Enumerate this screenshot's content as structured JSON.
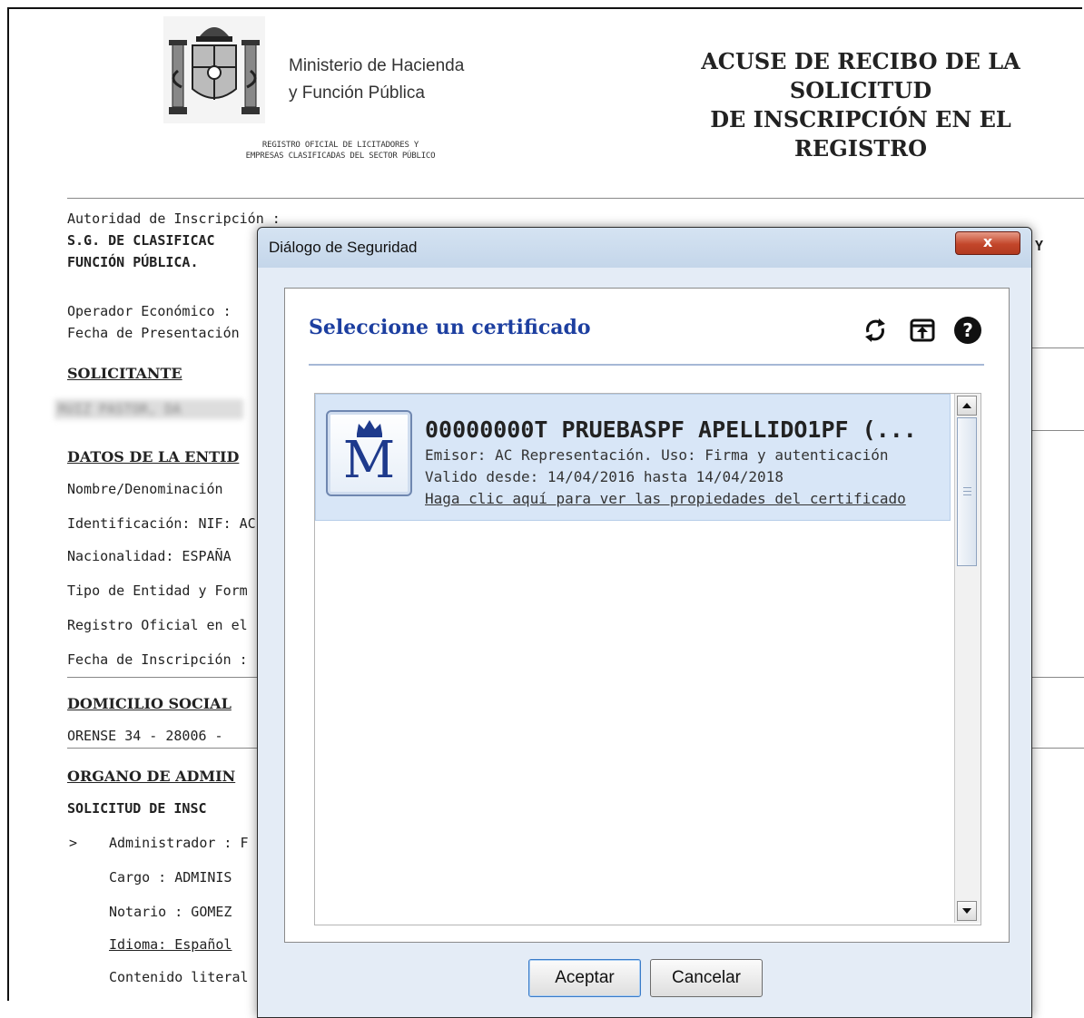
{
  "document": {
    "ministry_line1": "Ministerio de Hacienda",
    "ministry_line2": "y Función Pública",
    "registry_line1": "REGISTRO OFICIAL DE LICITADORES Y",
    "registry_line2": "EMPRESAS CLASIFICADAS DEL SECTOR PÚBLICO",
    "title_line1": "ACUSE DE RECIBO DE LA",
    "title_line2": "SOLICITUD",
    "title_line3": "DE INSCRIPCIÓN EN EL",
    "title_line4": "REGISTRO",
    "autoridad_label": "Autoridad de Inscripción :",
    "autoridad_value1": "S.G. DE CLASIFICAC",
    "autoridad_value2": "FUNCIÓN PÚBLICA.",
    "autoridad_value_end": "Y",
    "operador_label": "Operador Económico :",
    "fecha_presentacion_label": "Fecha de Presentación",
    "solicitante_heading": "SOLICITANTE",
    "solicitante_value": "RUIZ PASTOR, DA",
    "datos_heading": "DATOS DE LA ENTID",
    "nombre_label": "Nombre/Denominación",
    "identificacion_label": "Identificación: NIF:  AC",
    "nacionalidad_label": "Nacionalidad: ESPAÑA",
    "tipo_label": "Tipo de Entidad y Form",
    "registro_label": "Registro Oficial en el c",
    "fecha_inscripcion_label": "Fecha de Inscripción :",
    "domicilio_heading": "DOMICILIO SOCIAL",
    "domicilio_value": "ORENSE 34 - 28006 -",
    "organo_heading": "ORGANO DE ADMIN",
    "solicitud_heading": "SOLICITUD DE INSC",
    "bullet": ">",
    "administrador_label": "Administrador : F",
    "cargo_label": "Cargo : ADMINIS",
    "notario_label": "Notario : GOMEZ",
    "idioma_label": "Idioma: Español",
    "contenido_label": "Contenido literal"
  },
  "dialog": {
    "title": "Diálogo de Seguridad",
    "close_label": "x",
    "heading": "Seleccione un certificado",
    "certificate": {
      "title": "00000000T PRUEBASPF APELLIDO1PF (...",
      "emisor": "Emisor: AC Representación. Uso: Firma y autenticación",
      "validez": "Valido desde: 14/04/2016 hasta 14/04/2018",
      "link": "Haga clic aquí para ver las propiedades del certificado",
      "icon_letter": "M"
    },
    "accept_label": "Aceptar",
    "cancel_label": "Cancelar"
  },
  "colors": {
    "heading_blue": "#1d3fa0",
    "selected_row": "#d8e6f7",
    "close_red": "#c3462a"
  },
  "icons": [
    "coat-of-arms-icon",
    "refresh-icon",
    "import-icon",
    "help-icon",
    "crown-icon",
    "scroll-up-icon",
    "scroll-down-icon"
  ]
}
